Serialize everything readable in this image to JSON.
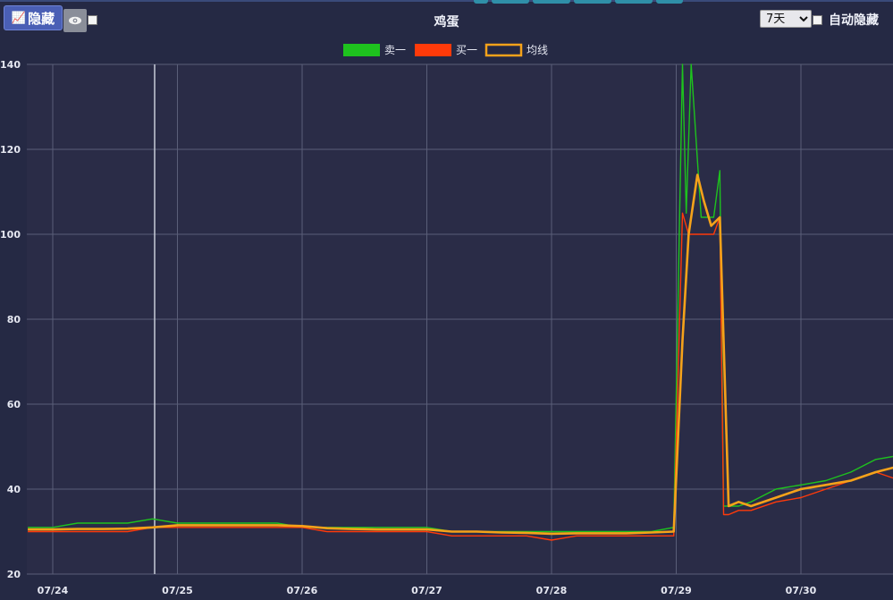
{
  "toolbar": {
    "hide_label": "隐藏",
    "hide_icon": "chart-icon",
    "eye_icon": "eye-icon",
    "range_value": "7天",
    "auto_hide_label": "自动隐藏"
  },
  "chart_data": {
    "type": "line",
    "title": "鸡蛋",
    "xlabel": "",
    "ylabel": "",
    "ylim": [
      20,
      140
    ],
    "yticks": [
      20,
      40,
      60,
      80,
      100,
      120,
      140
    ],
    "xticks": [
      "07/24",
      "07/25",
      "07/26",
      "07/27",
      "07/28",
      "07/29",
      "07/30"
    ],
    "grid": true,
    "legend_position": "top-center",
    "colors": {
      "卖一": "#1ec21e",
      "买一": "#ff3a0a",
      "均线": "#f5a21a"
    },
    "series": [
      {
        "name": "卖一",
        "x": [
          -0.2,
          0,
          0.2,
          0.4,
          0.6,
          0.8,
          1.0,
          1.2,
          1.4,
          1.6,
          1.8,
          2.0,
          2.2,
          2.4,
          2.6,
          2.8,
          3.0,
          3.2,
          3.4,
          3.6,
          3.8,
          4.0,
          4.2,
          4.4,
          4.6,
          4.8,
          4.98,
          5.05,
          5.08,
          5.12,
          5.2,
          5.3,
          5.35,
          5.38,
          5.42,
          5.5,
          5.6,
          5.8,
          6.0,
          6.2,
          6.4,
          6.6,
          6.8
        ],
        "values": [
          31,
          31,
          32,
          32,
          32,
          33,
          32,
          32,
          32,
          32,
          32,
          31,
          31,
          31,
          31,
          31,
          31,
          30,
          30,
          30,
          30,
          30,
          30,
          30,
          30,
          30,
          31,
          140,
          105,
          140,
          104,
          104,
          115,
          36,
          36,
          36,
          37,
          40,
          41,
          42,
          44,
          47,
          48
        ]
      },
      {
        "name": "买一",
        "x": [
          -0.2,
          0,
          0.2,
          0.4,
          0.6,
          0.8,
          1.0,
          1.2,
          1.4,
          1.6,
          1.8,
          2.0,
          2.2,
          2.4,
          2.6,
          2.8,
          3.0,
          3.2,
          3.4,
          3.6,
          3.8,
          4.0,
          4.2,
          4.4,
          4.6,
          4.8,
          4.98,
          5.05,
          5.1,
          5.2,
          5.3,
          5.35,
          5.38,
          5.42,
          5.5,
          5.6,
          5.8,
          6.0,
          6.2,
          6.4,
          6.6,
          6.8
        ],
        "values": [
          30,
          30,
          30,
          30,
          30,
          31,
          31,
          31,
          31,
          31,
          31,
          31,
          30,
          30,
          30,
          30,
          30,
          29,
          29,
          29,
          29,
          28,
          29,
          29,
          29,
          29,
          29,
          105,
          100,
          100,
          100,
          104,
          34,
          34,
          35,
          35,
          37,
          38,
          40,
          42,
          44,
          42
        ]
      },
      {
        "name": "均线",
        "x": [
          -0.2,
          0,
          0.2,
          0.4,
          0.6,
          0.8,
          1.0,
          1.2,
          1.4,
          1.6,
          1.8,
          2.0,
          2.2,
          2.4,
          2.6,
          2.8,
          3.0,
          3.2,
          3.4,
          3.6,
          3.8,
          4.0,
          4.2,
          4.4,
          4.6,
          4.8,
          4.98,
          5.05,
          5.1,
          5.17,
          5.22,
          5.28,
          5.35,
          5.42,
          5.5,
          5.6,
          5.8,
          6.0,
          6.2,
          6.4,
          6.6,
          6.8
        ],
        "values": [
          30.5,
          30.5,
          30.6,
          30.6,
          30.7,
          31,
          31.5,
          31.5,
          31.5,
          31.5,
          31.5,
          31.3,
          30.8,
          30.6,
          30.5,
          30.5,
          30.5,
          30,
          30,
          29.8,
          29.7,
          29.5,
          29.6,
          29.6,
          29.6,
          29.8,
          30,
          75,
          100,
          114,
          108,
          102,
          104,
          36,
          37,
          36,
          38,
          40,
          41,
          42,
          44,
          45.5
        ]
      }
    ]
  }
}
